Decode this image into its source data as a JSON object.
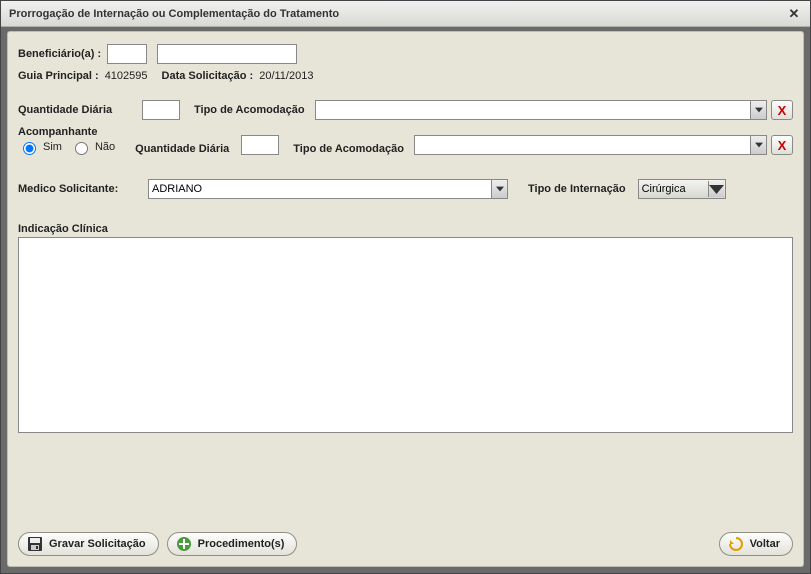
{
  "window": {
    "title": "Prorrogação de Internação ou Complementação do Tratamento",
    "close_symbol": "✕"
  },
  "beneficiario": {
    "label": "Beneficiário(a) :",
    "code_value": "",
    "name_value": ""
  },
  "guia": {
    "label": "Guia Principal :",
    "value": "4102595"
  },
  "data_solicitacao": {
    "label": "Data Solicitação :",
    "value": "20/11/2013"
  },
  "diarias": {
    "qtd_label": "Quantidade Diária",
    "qtd_value": "",
    "tipo_acomod_label": "Tipo de Acomodação",
    "tipo_acomod_value": "",
    "remove_label": "X"
  },
  "acompanhante": {
    "group_label": "Acompanhante",
    "sim_label": "Sim",
    "nao_label": "Não",
    "selected": "sim",
    "qtd_label": "Quantidade Diária",
    "qtd_value": "",
    "tipo_acomod_label": "Tipo de Acomodação",
    "tipo_acomod_value": "",
    "remove_label": "X"
  },
  "medico": {
    "label": "Medico Solicitante:",
    "value": "ADRIANO"
  },
  "tipo_internacao": {
    "label": "Tipo de Internação",
    "value": "Cirúrgica"
  },
  "indicacao": {
    "label": "Indicação Clínica",
    "value": ""
  },
  "footer": {
    "gravar_label": "Gravar Solicitação",
    "procedimentos_label": "Procedimento(s)",
    "voltar_label": "Voltar"
  }
}
